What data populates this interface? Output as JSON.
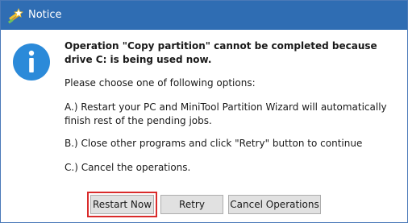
{
  "window": {
    "title": "Notice"
  },
  "icons": {
    "app": "wizard-wand-icon",
    "info": "info-icon"
  },
  "message": {
    "headline": "Operation \"Copy partition\" cannot be completed because drive C: is being used now.",
    "prompt": "Please choose one of following options:",
    "option_a": "A.) Restart your PC and MiniTool Partition Wizard will automatically finish rest of the pending jobs.",
    "option_b": "B.) Close other programs and click \"Retry\" button to continue",
    "option_c": "C.) Cancel the operations."
  },
  "buttons": {
    "restart_now": "Restart Now",
    "retry": "Retry",
    "cancel_operations": "Cancel Operations"
  },
  "colors": {
    "titlebar": "#2f6db3",
    "info_icon": "#2b8ad9",
    "highlight": "#d92b2b"
  }
}
